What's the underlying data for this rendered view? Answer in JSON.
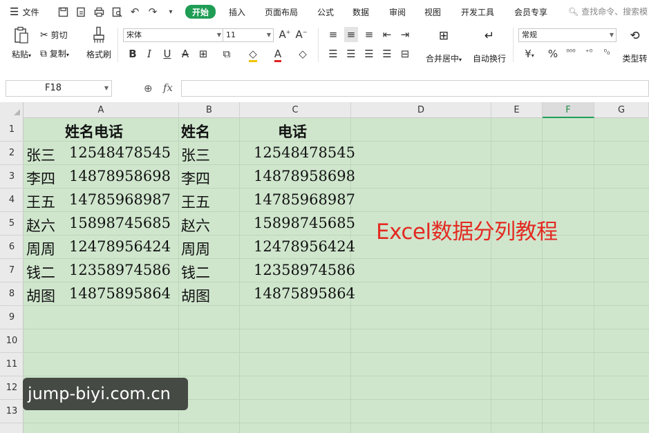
{
  "menu": {
    "file": "文件",
    "tabs": [
      "开始",
      "插入",
      "页面布局",
      "公式",
      "数据",
      "审阅",
      "视图",
      "开发工具",
      "会员专享"
    ],
    "search": "查找命令、搜索模"
  },
  "ribbon": {
    "paste": "粘贴",
    "cut": "剪切",
    "copy": "复制",
    "format_painter": "格式刷",
    "font_name": "宋体",
    "font_size": "11",
    "merge_center": "合并居中",
    "wrap_text": "自动换行",
    "number_format": "常规",
    "type_convert": "类型转",
    "currency_symbol": "¥",
    "percent_symbol": "%"
  },
  "formula_bar": {
    "name_box": "F18",
    "fx": "fx"
  },
  "columns": [
    "A",
    "B",
    "C",
    "D",
    "E",
    "F",
    "G"
  ],
  "selected_column": "F",
  "rows": [
    "1",
    "2",
    "3",
    "4",
    "5",
    "6",
    "7",
    "8",
    "9",
    "10",
    "11",
    "12",
    "13"
  ],
  "table": {
    "headers": [
      "姓名电话",
      "姓名",
      "电话"
    ],
    "records": [
      [
        "张三",
        "12548478545",
        "张三",
        "12548478545"
      ],
      [
        "李四",
        "14878958698",
        "李四",
        "14878958698"
      ],
      [
        "王五",
        "14785968987",
        "王五",
        "14785968987"
      ],
      [
        "赵六",
        "15898745685",
        "赵六",
        "15898745685"
      ],
      [
        "周周",
        "12478956424",
        "周周",
        "12478956424"
      ],
      [
        "钱二",
        "12358974586",
        "钱二",
        "12358974586"
      ],
      [
        "胡图",
        "14875895864",
        "胡图",
        "14875895864"
      ]
    ]
  },
  "annotation": "Excel数据分列教程",
  "watermark": "jump-biyi.com.cn",
  "colors": {
    "accent": "#1f9d55",
    "cell_bg": "#cfe6cd",
    "annotation": "#e32a22"
  }
}
